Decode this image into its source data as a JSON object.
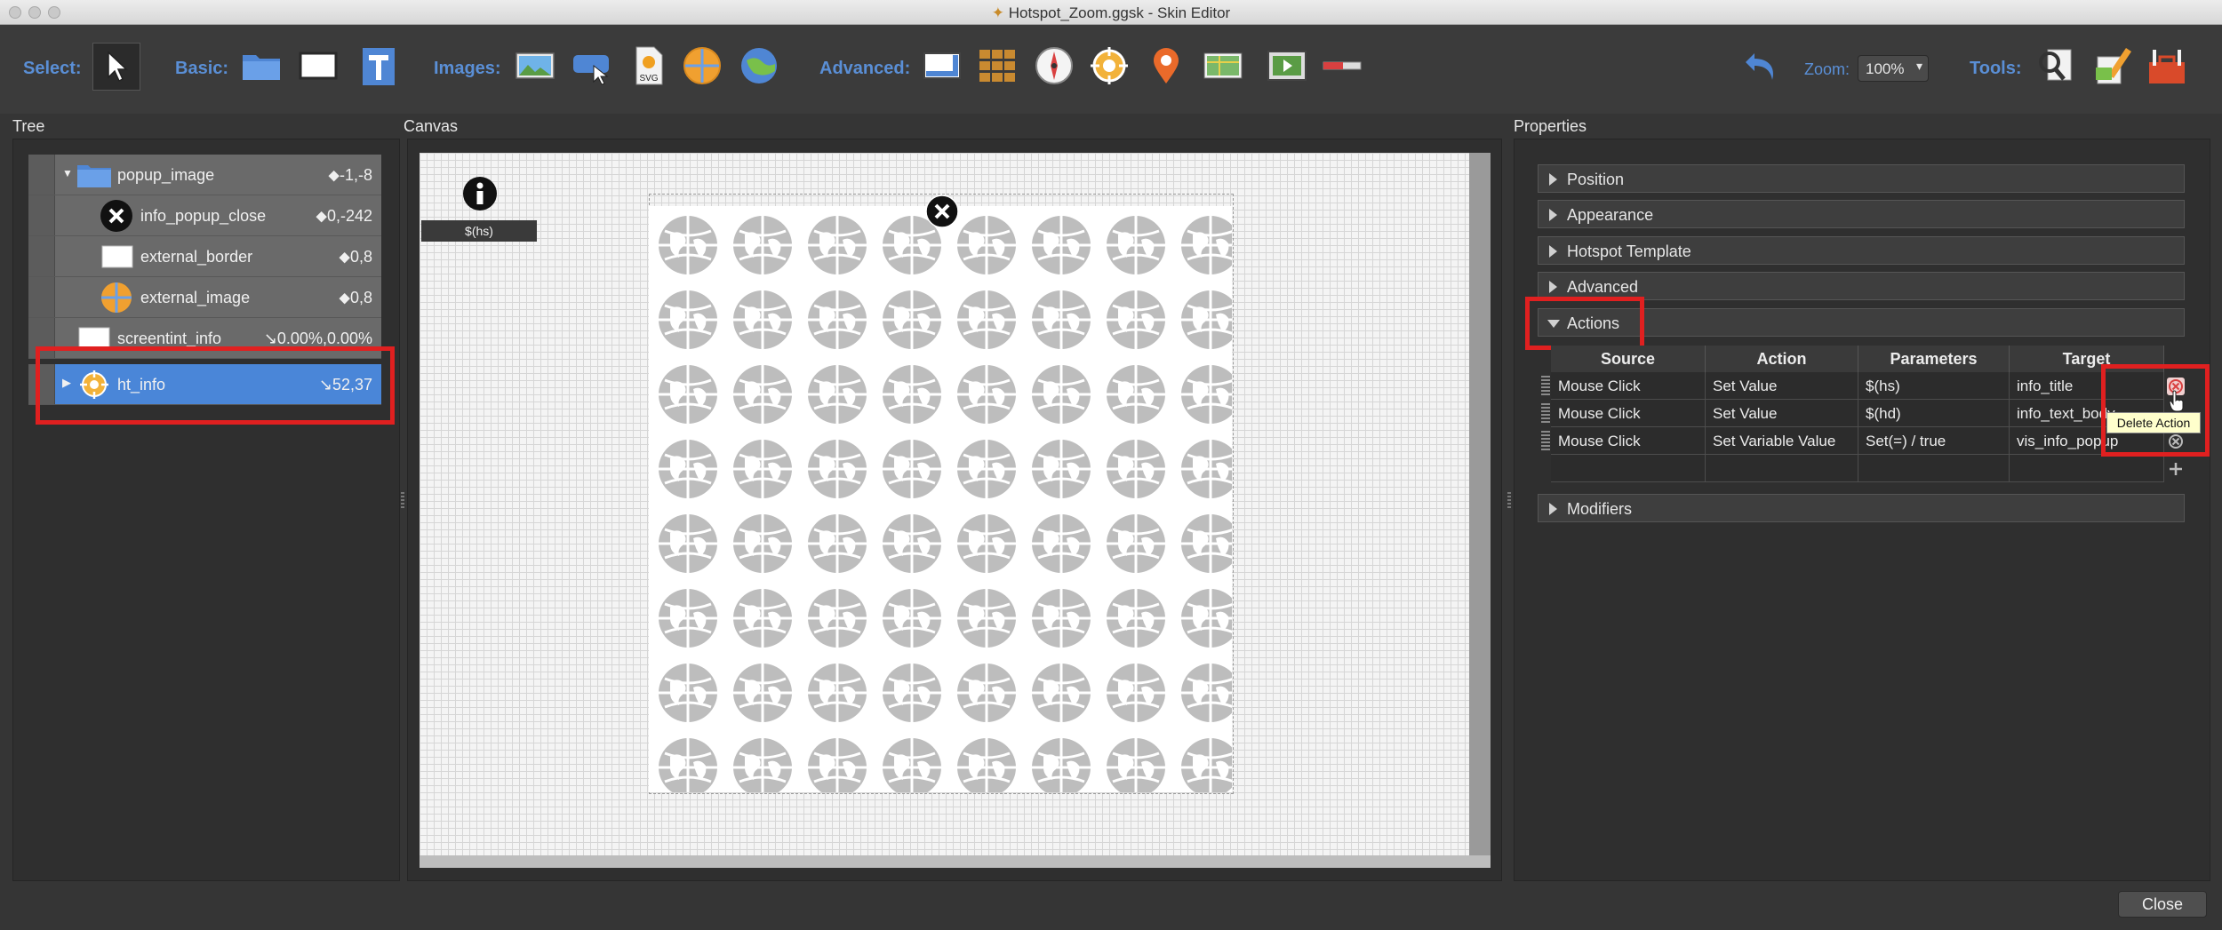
{
  "window": {
    "title": "Hotspot_Zoom.ggsk - Skin Editor"
  },
  "toolbar": {
    "select_label": "Select:",
    "basic_label": "Basic:",
    "images_label": "Images:",
    "svg_text": "SVG",
    "advanced_label": "Advanced:",
    "zoom_label": "Zoom:",
    "zoom_value": "100%",
    "tools_label": "Tools:"
  },
  "panels": {
    "tree": "Tree",
    "canvas": "Canvas",
    "properties": "Properties"
  },
  "tree": {
    "items": [
      {
        "name": "popup_image",
        "coord": "⬥-1,-8"
      },
      {
        "name": "info_popup_close",
        "coord": "⬥0,-242"
      },
      {
        "name": "external_border",
        "coord": "⬥0,8"
      },
      {
        "name": "external_image",
        "coord": "⬥0,8"
      },
      {
        "name": "screentint_info",
        "coord": "↘0.00%,0.00%"
      },
      {
        "name": "ht_info",
        "coord": "↘52,37"
      }
    ]
  },
  "canvas": {
    "hotspot_label": "$(hs)"
  },
  "properties": {
    "sections": [
      "Position",
      "Appearance",
      "Hotspot Template",
      "Advanced",
      "Actions",
      "Modifiers"
    ],
    "table": {
      "headers": [
        "Source",
        "Action",
        "Parameters",
        "Target"
      ],
      "rows": [
        {
          "source": "Mouse Click",
          "action": "Set Value",
          "params": "$(hs)",
          "target": "info_title"
        },
        {
          "source": "Mouse Click",
          "action": "Set Value",
          "params": "$(hd)",
          "target": "info_text_body"
        },
        {
          "source": "Mouse Click",
          "action": "Set Variable Value",
          "params": "Set(=) / true",
          "target": "vis_info_popup"
        }
      ]
    },
    "tooltip": "Delete Action"
  },
  "footer": {
    "close": "Close"
  },
  "colors": {
    "accent": "#5a8fd6",
    "selection": "#4a86d8",
    "highlight": "#e02020"
  }
}
